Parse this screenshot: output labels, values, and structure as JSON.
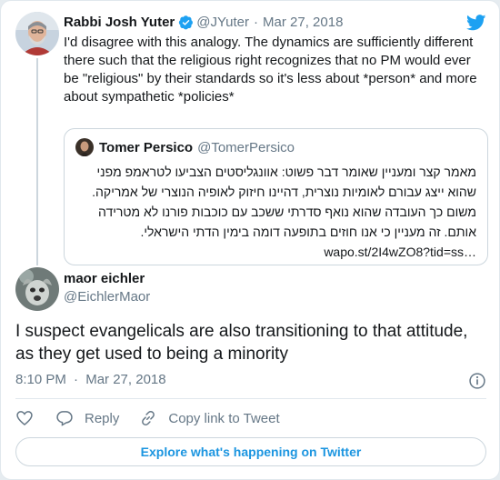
{
  "colors": {
    "brand": "#1DA1F2",
    "link": "#1b95e0",
    "muted": "#657786",
    "border": "#ccd6dd"
  },
  "parent_tweet": {
    "author_name": "Rabbi Josh Yuter",
    "handle": "@JYuter",
    "separator": "·",
    "date": "Mar 27, 2018",
    "verified_icon": "verified-badge-icon",
    "text": "I'd disagree with this analogy. The dynamics are sufficiently different\nthere such that the religious right recognizes that no PM would ever\nbe \"religious\" by their standards so it's less about *person* and more\nabout sympathetic *policies*"
  },
  "quoted_tweet": {
    "author_name": "Tomer Persico",
    "handle": "@TomerPersico",
    "text": "מאמר קצר ומעניין שאומר דבר פשוט: אוונגליסטים הצביעו לטראמפ מפני\nשהוא ייצג עבורם לאומיות נוצרית, דהיינו חיזוק לאופיה הנוצרי של אמריקה.\nמשום כך העובדה שהוא נואף סדרתי ששכב עם כוכבות פורנו לא מטרידה\nאותם. זה מעניין כי אנו חוזים בתופעה דומה בימין הדתי הישראלי.",
    "link": "wapo.st/2I4wZO8?tid=ss…"
  },
  "main_tweet": {
    "author_name": "maor eichler",
    "handle": "@EichlerMaor",
    "text": "I suspect evangelicals are also transitioning to that attitude, as they get used to being a minority",
    "time": "8:10 PM",
    "separator": "·",
    "date": "Mar 27, 2018"
  },
  "actions": {
    "like_icon": "heart-icon",
    "reply_label": "Reply",
    "copy_link_label": "Copy link to Tweet"
  },
  "footer": {
    "explore_label": "Explore what's happening on Twitter"
  },
  "icons": {
    "brand_logo": "twitter-bird-icon",
    "info": "info-icon",
    "reply": "reply-bubble-icon",
    "link": "link-chain-icon"
  }
}
